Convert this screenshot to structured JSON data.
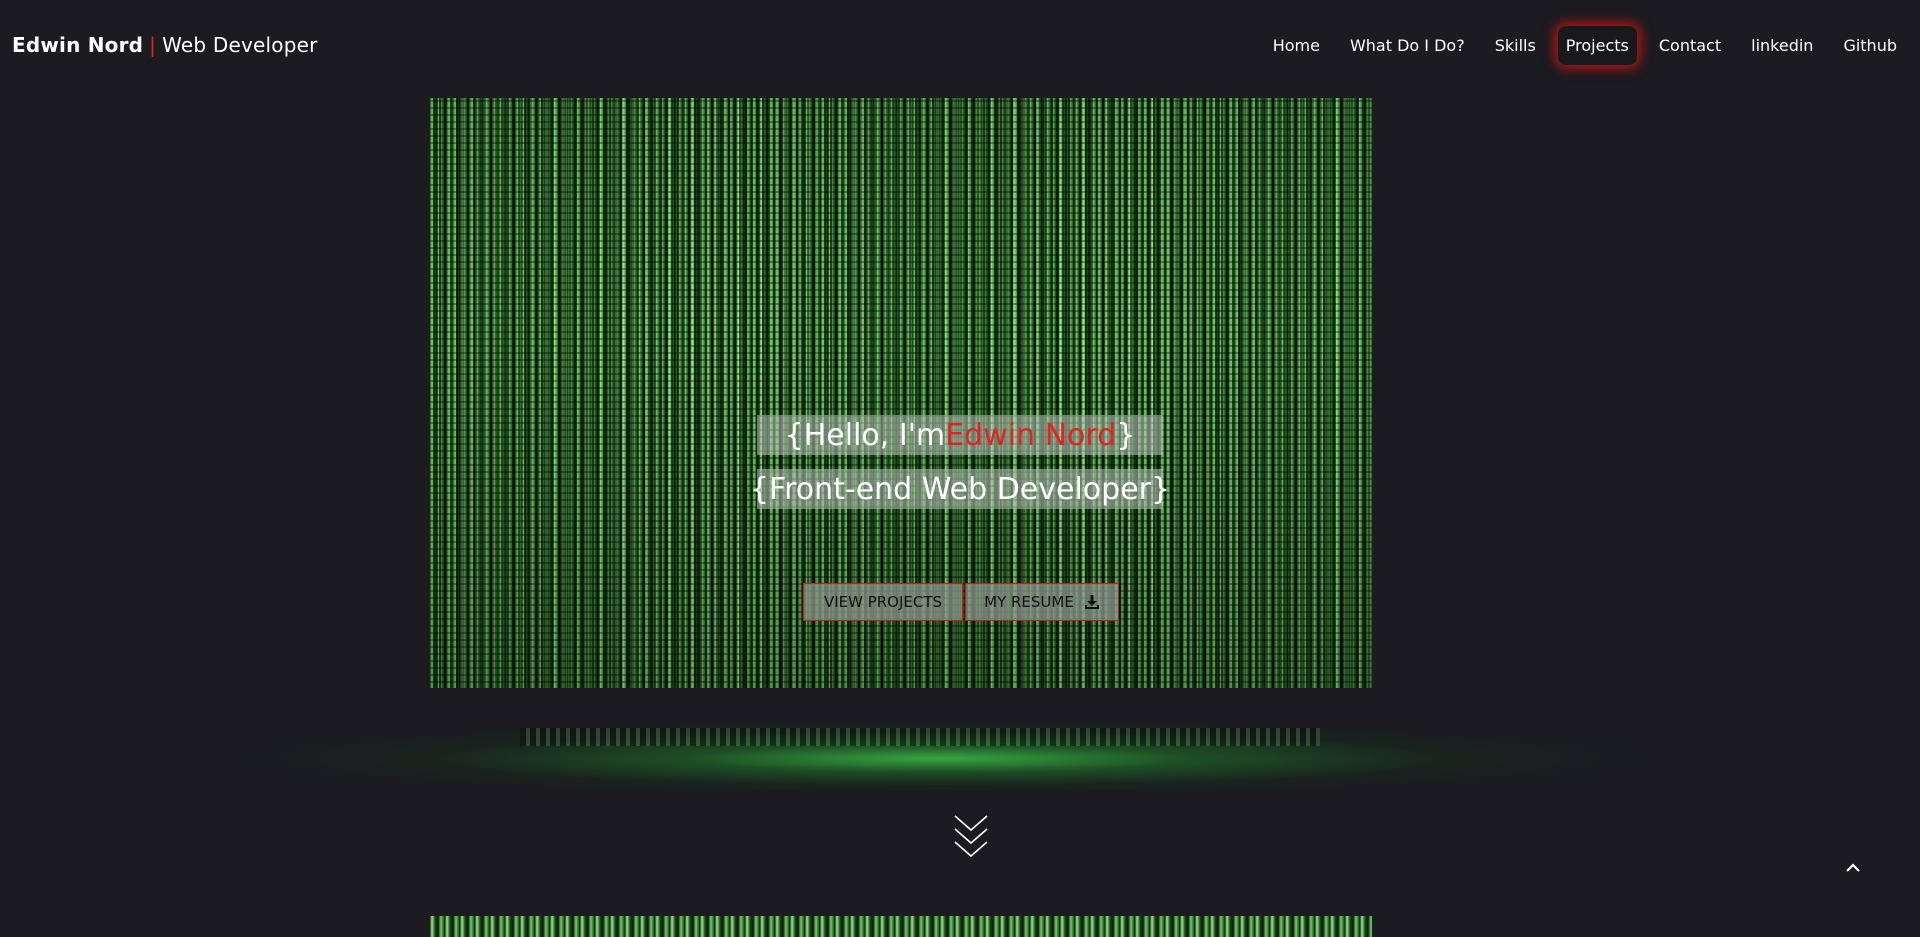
{
  "navbar": {
    "brand_name": "Edwin Nord",
    "brand_separator": "|",
    "brand_role": "Web Developer",
    "items": [
      {
        "label": "Home"
      },
      {
        "label": "What Do I Do?"
      },
      {
        "label": "Skills"
      },
      {
        "label": "Projects",
        "active": true
      },
      {
        "label": "Contact"
      },
      {
        "label": "linkedin"
      },
      {
        "label": "Github"
      }
    ]
  },
  "hero": {
    "greeting_prefix": "{Hello, I'm ",
    "greeting_name": "Edwin Nord",
    "greeting_suffix": "}",
    "subtitle": "{Front-end Web Developer}",
    "view_projects_label": "VIEW PROJECTS",
    "resume_label": "MY RESUME",
    "resume_icon": "download-icon"
  },
  "icons": {
    "scroll_down": "double-chevron-down-icon",
    "back_to_top": "chevron-up-icon"
  },
  "colors": {
    "background": "#1b1b20",
    "accent": "#e02424",
    "matrix_green": "#8de07f"
  }
}
